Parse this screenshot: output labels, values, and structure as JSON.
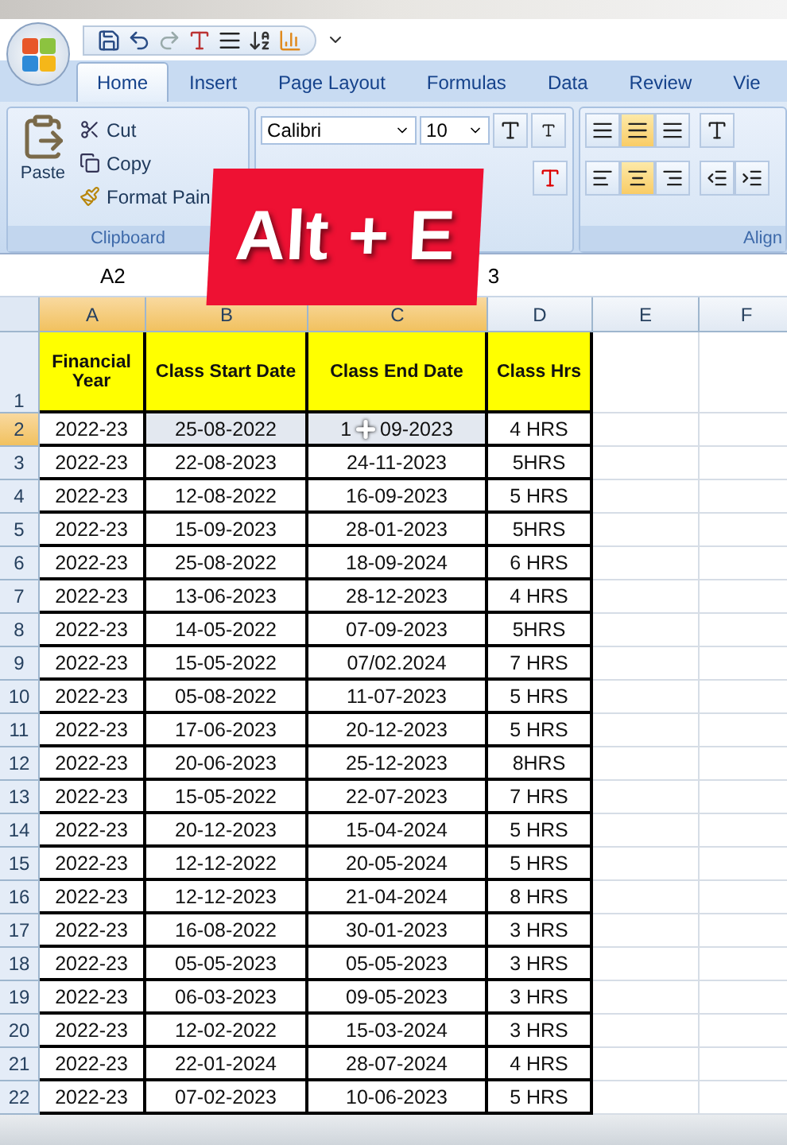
{
  "tabs": [
    {
      "label": "Home",
      "selected": true
    },
    {
      "label": "Insert",
      "selected": false
    },
    {
      "label": "Page Layout",
      "selected": false
    },
    {
      "label": "Formulas",
      "selected": false
    },
    {
      "label": "Data",
      "selected": false
    },
    {
      "label": "Review",
      "selected": false
    },
    {
      "label": "Vie",
      "selected": false
    }
  ],
  "clipboard": {
    "paste": "Paste",
    "cut": "Cut",
    "copy": "Copy",
    "format_painter": "Format Pain",
    "label": "Clipboard"
  },
  "font": {
    "name": "Calibri",
    "size": "10"
  },
  "alignment": {
    "label": "Align",
    "vertical": [
      {
        "selected": false
      },
      {
        "selected": true
      },
      {
        "selected": false
      }
    ],
    "horizontal": [
      {
        "selected": false
      },
      {
        "selected": true
      },
      {
        "selected": false
      }
    ]
  },
  "overlay_caption": "Alt + E",
  "name_box": "A2",
  "formula_bar": {
    "value": "3"
  },
  "columns": [
    {
      "label": "A",
      "highlighted": true
    },
    {
      "label": "B",
      "highlighted": true
    },
    {
      "label": "C",
      "highlighted": true
    },
    {
      "label": "D",
      "highlighted": false
    },
    {
      "label": "E",
      "highlighted": false
    },
    {
      "label": "F",
      "highlighted": false
    }
  ],
  "header_row": {
    "number": "1",
    "cells": [
      "Financial Year",
      "Class Start Date",
      "Class End Date",
      "Class Hrs"
    ]
  },
  "rows": [
    {
      "number": "2",
      "selected": true,
      "cells": [
        "2022-23",
        "25-08-2022",
        {
          "before": "1",
          "after": "09-2023"
        },
        "4 HRS"
      ]
    },
    {
      "number": "3",
      "selected": false,
      "cells": [
        "2022-23",
        "22-08-2023",
        "24-11-2023",
        "5HRS"
      ]
    },
    {
      "number": "4",
      "selected": false,
      "cells": [
        "2022-23",
        "12-08-2022",
        "16-09-2023",
        "5 HRS"
      ]
    },
    {
      "number": "5",
      "selected": false,
      "cells": [
        "2022-23",
        "15-09-2023",
        "28-01-2023",
        "5HRS"
      ]
    },
    {
      "number": "6",
      "selected": false,
      "cells": [
        "2022-23",
        "25-08-2022",
        "18-09-2024",
        "6 HRS"
      ]
    },
    {
      "number": "7",
      "selected": false,
      "cells": [
        "2022-23",
        "13-06-2023",
        "28-12-2023",
        "4 HRS"
      ]
    },
    {
      "number": "8",
      "selected": false,
      "cells": [
        "2022-23",
        "14-05-2022",
        "07-09-2023",
        "5HRS"
      ]
    },
    {
      "number": "9",
      "selected": false,
      "cells": [
        "2022-23",
        "15-05-2022",
        "07/02.2024",
        "7 HRS"
      ]
    },
    {
      "number": "10",
      "selected": false,
      "cells": [
        "2022-23",
        "05-08-2022",
        "11-07-2023",
        "5 HRS"
      ]
    },
    {
      "number": "11",
      "selected": false,
      "cells": [
        "2022-23",
        "17-06-2023",
        "20-12-2023",
        "5 HRS"
      ]
    },
    {
      "number": "12",
      "selected": false,
      "cells": [
        "2022-23",
        "20-06-2023",
        "25-12-2023",
        "8HRS"
      ]
    },
    {
      "number": "13",
      "selected": false,
      "cells": [
        "2022-23",
        "15-05-2022",
        "22-07-2023",
        "7 HRS"
      ]
    },
    {
      "number": "14",
      "selected": false,
      "cells": [
        "2022-23",
        "20-12-2023",
        "15-04-2024",
        "5 HRS"
      ]
    },
    {
      "number": "15",
      "selected": false,
      "cells": [
        "2022-23",
        "12-12-2022",
        "20-05-2024",
        "5 HRS"
      ]
    },
    {
      "number": "16",
      "selected": false,
      "cells": [
        "2022-23",
        "12-12-2023",
        "21-04-2024",
        "8 HRS"
      ]
    },
    {
      "number": "17",
      "selected": false,
      "cells": [
        "2022-23",
        "16-08-2022",
        "30-01-2023",
        "3 HRS"
      ]
    },
    {
      "number": "18",
      "selected": false,
      "cells": [
        "2022-23",
        "05-05-2023",
        "05-05-2023",
        "3 HRS"
      ]
    },
    {
      "number": "19",
      "selected": false,
      "cells": [
        "2022-23",
        "06-03-2023",
        "09-05-2023",
        "3 HRS"
      ]
    },
    {
      "number": "20",
      "selected": false,
      "cells": [
        "2022-23",
        "12-02-2022",
        "15-03-2024",
        "3 HRS"
      ]
    },
    {
      "number": "21",
      "selected": false,
      "cells": [
        "2022-23",
        "22-01-2024",
        "28-07-2024",
        "4 HRS"
      ]
    },
    {
      "number": "22",
      "selected": false,
      "cells": [
        "2022-23",
        "07-02-2023",
        "10-06-2023",
        "5 HRS"
      ]
    }
  ]
}
